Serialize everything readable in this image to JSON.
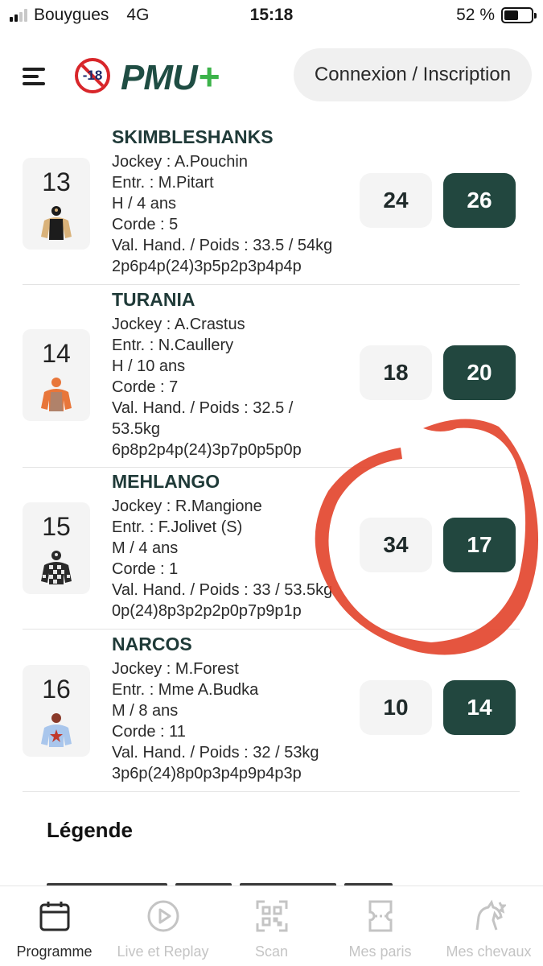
{
  "status_bar": {
    "carrier": "Bouygues",
    "network": "4G",
    "time": "15:18",
    "battery": "52 %",
    "battery_level": 0.52
  },
  "header": {
    "age_badge": "-18",
    "logo": "PMU",
    "logo_plus": "+",
    "login_label": "Connexion / Inscription"
  },
  "runners": [
    {
      "number": "13",
      "name": "SKIMBLESHANKS",
      "jockey": "Jockey : A.Pouchin",
      "trainer": "Entr. : M.Pitart",
      "age": "H / 4 ans",
      "corde": "Corde : 5",
      "hand": "Val. Hand. / Poids : 33.5 / 54kg",
      "hand2": "",
      "musique": "2p6p4p(24)3p5p2p3p4p4p",
      "odd_ref": "24",
      "odd_live": "26",
      "jersey_colors": [
        "#1c1c1c",
        "#d9b27a"
      ]
    },
    {
      "number": "14",
      "name": "TURANIA",
      "jockey": "Jockey : A.Crastus",
      "trainer": "Entr. : N.Caullery",
      "age": "H / 10 ans",
      "corde": "Corde : 7",
      "hand": "Val. Hand. / Poids : 32.5 /",
      "hand2": "53.5kg",
      "musique": "6p8p2p4p(24)3p7p0p5p0p",
      "odd_ref": "18",
      "odd_live": "20",
      "jersey_colors": [
        "#e8763a",
        "#8a8a8a"
      ]
    },
    {
      "number": "15",
      "name": "MEHLANGO",
      "jockey": "Jockey : R.Mangione",
      "trainer": "Entr. : F.Jolivet (S)",
      "age": "M / 4 ans",
      "corde": "Corde : 1",
      "hand": "Val. Hand. / Poids : 33 / 53.5kg",
      "hand2": "",
      "musique": "0p(24)8p3p2p2p0p7p9p1p",
      "odd_ref": "34",
      "odd_live": "17",
      "jersey_colors": [
        "#2a2a2a",
        "#e6e6e6"
      ]
    },
    {
      "number": "16",
      "name": "NARCOS",
      "jockey": "Jockey : M.Forest",
      "trainer": "Entr. : Mme A.Budka",
      "age": "M / 8 ans",
      "corde": "Corde : 11",
      "hand": "Val. Hand. / Poids : 32 / 53kg",
      "hand2": "",
      "musique": "3p6p(24)8p0p3p4p9p4p3p",
      "odd_ref": "10",
      "odd_live": "14",
      "jersey_colors": [
        "#a9c6ec",
        "#c0392b"
      ]
    }
  ],
  "legend": {
    "title": "Légende"
  },
  "bottom_nav": {
    "items": [
      {
        "label": "Programme",
        "icon": "calendar-icon",
        "active": true
      },
      {
        "label": "Live et Replay",
        "icon": "play-circle-icon",
        "active": false
      },
      {
        "label": "Scan",
        "icon": "qr-code-icon",
        "active": false
      },
      {
        "label": "Mes paris",
        "icon": "ticket-icon",
        "active": false
      },
      {
        "label": "Mes chevaux",
        "icon": "horse-icon",
        "active": false
      }
    ]
  },
  "annotation": {
    "color": "#e2432a"
  }
}
